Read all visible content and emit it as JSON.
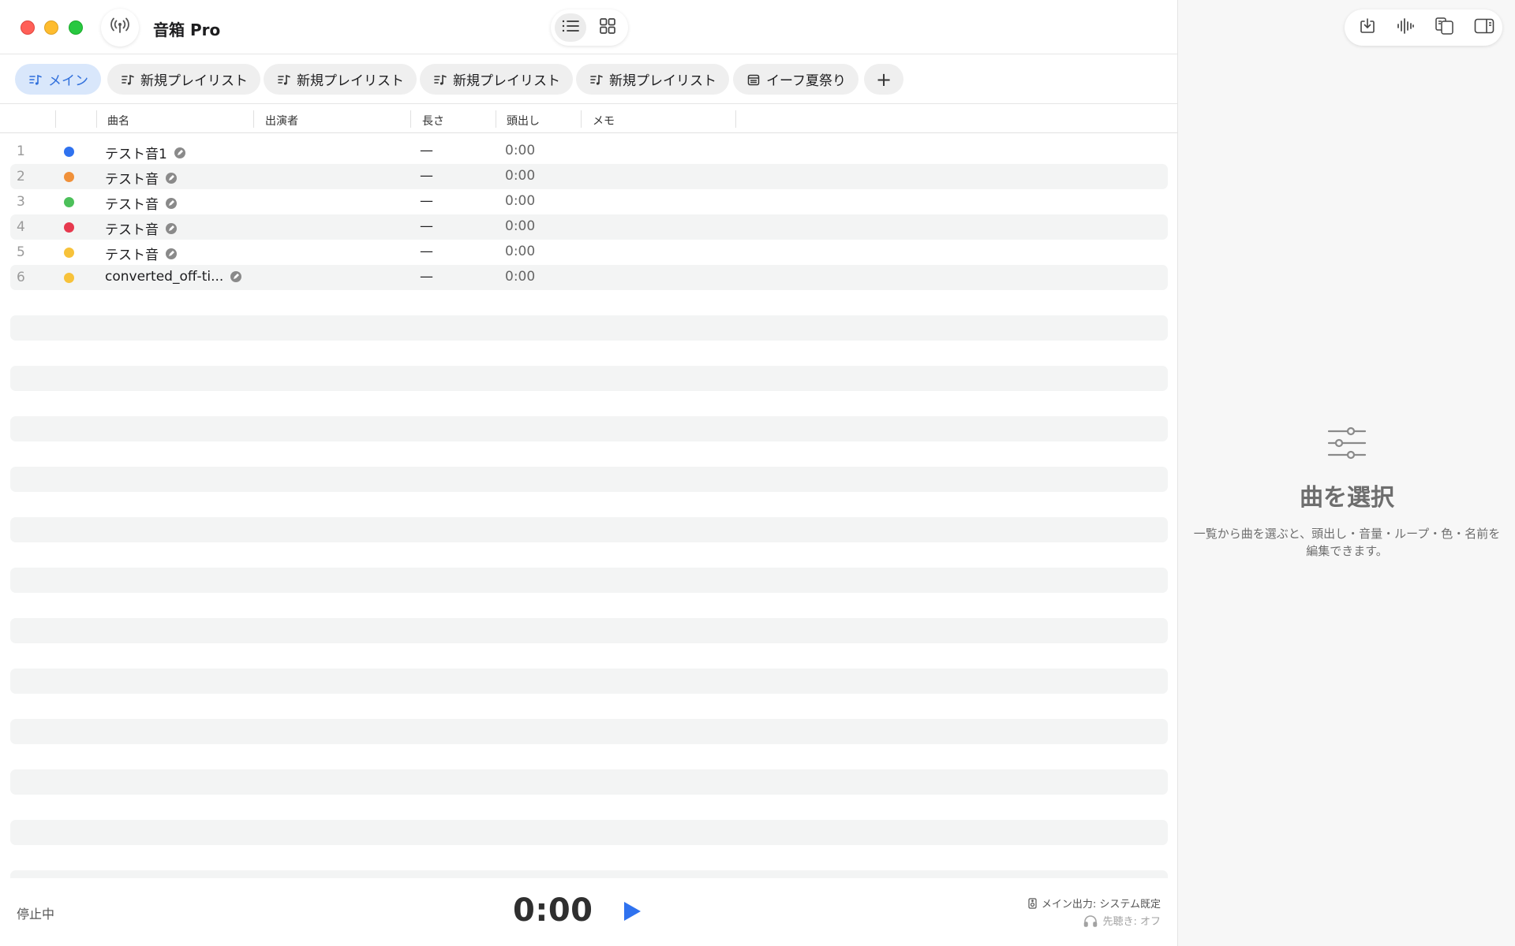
{
  "window": {
    "title": "音箱 Pro"
  },
  "tabs": [
    {
      "label": "メイン",
      "active": true,
      "icon": "music-list-icon"
    },
    {
      "label": "新規プレイリスト",
      "active": false,
      "icon": "music-list-icon"
    },
    {
      "label": "新規プレイリスト",
      "active": false,
      "icon": "music-list-icon"
    },
    {
      "label": "新規プレイリスト",
      "active": false,
      "icon": "music-list-icon"
    },
    {
      "label": "新規プレイリスト",
      "active": false,
      "icon": "music-list-icon"
    },
    {
      "label": "イーフ夏祭り",
      "active": false,
      "icon": "calendar-icon"
    }
  ],
  "add_tab_label": "+",
  "columns": {
    "title": "曲名",
    "performer": "出演者",
    "length": "長さ",
    "cue": "頭出し",
    "memo": "メモ"
  },
  "tracks": [
    {
      "num": "1",
      "color": "#2f72ef",
      "title": "テスト音1",
      "length": "—",
      "cue": "0:00"
    },
    {
      "num": "2",
      "color": "#f0913a",
      "title": "テスト音",
      "length": "—",
      "cue": "0:00"
    },
    {
      "num": "3",
      "color": "#4cc05a",
      "title": "テスト音",
      "length": "—",
      "cue": "0:00"
    },
    {
      "num": "4",
      "color": "#e6394e",
      "title": "テスト音",
      "length": "—",
      "cue": "0:00"
    },
    {
      "num": "5",
      "color": "#f7c23a",
      "title": "テスト音",
      "length": "—",
      "cue": "0:00"
    },
    {
      "num": "6",
      "color": "#f7c23a",
      "title": "converted_off-ti...",
      "length": "—",
      "cue": "0:00"
    }
  ],
  "transport": {
    "status": "停止中",
    "time": "0:00",
    "output_label": "メイン出力: システム既定",
    "preview_label": "先聴き: オフ"
  },
  "inspector": {
    "empty_title": "曲を選択",
    "empty_desc": "一覧から曲を選ぶと、頭出し・音量・ループ・色・名前を編集できます。"
  },
  "colors": {
    "accent": "#2f72ef",
    "active_tab_bg": "#d9e7fb"
  }
}
